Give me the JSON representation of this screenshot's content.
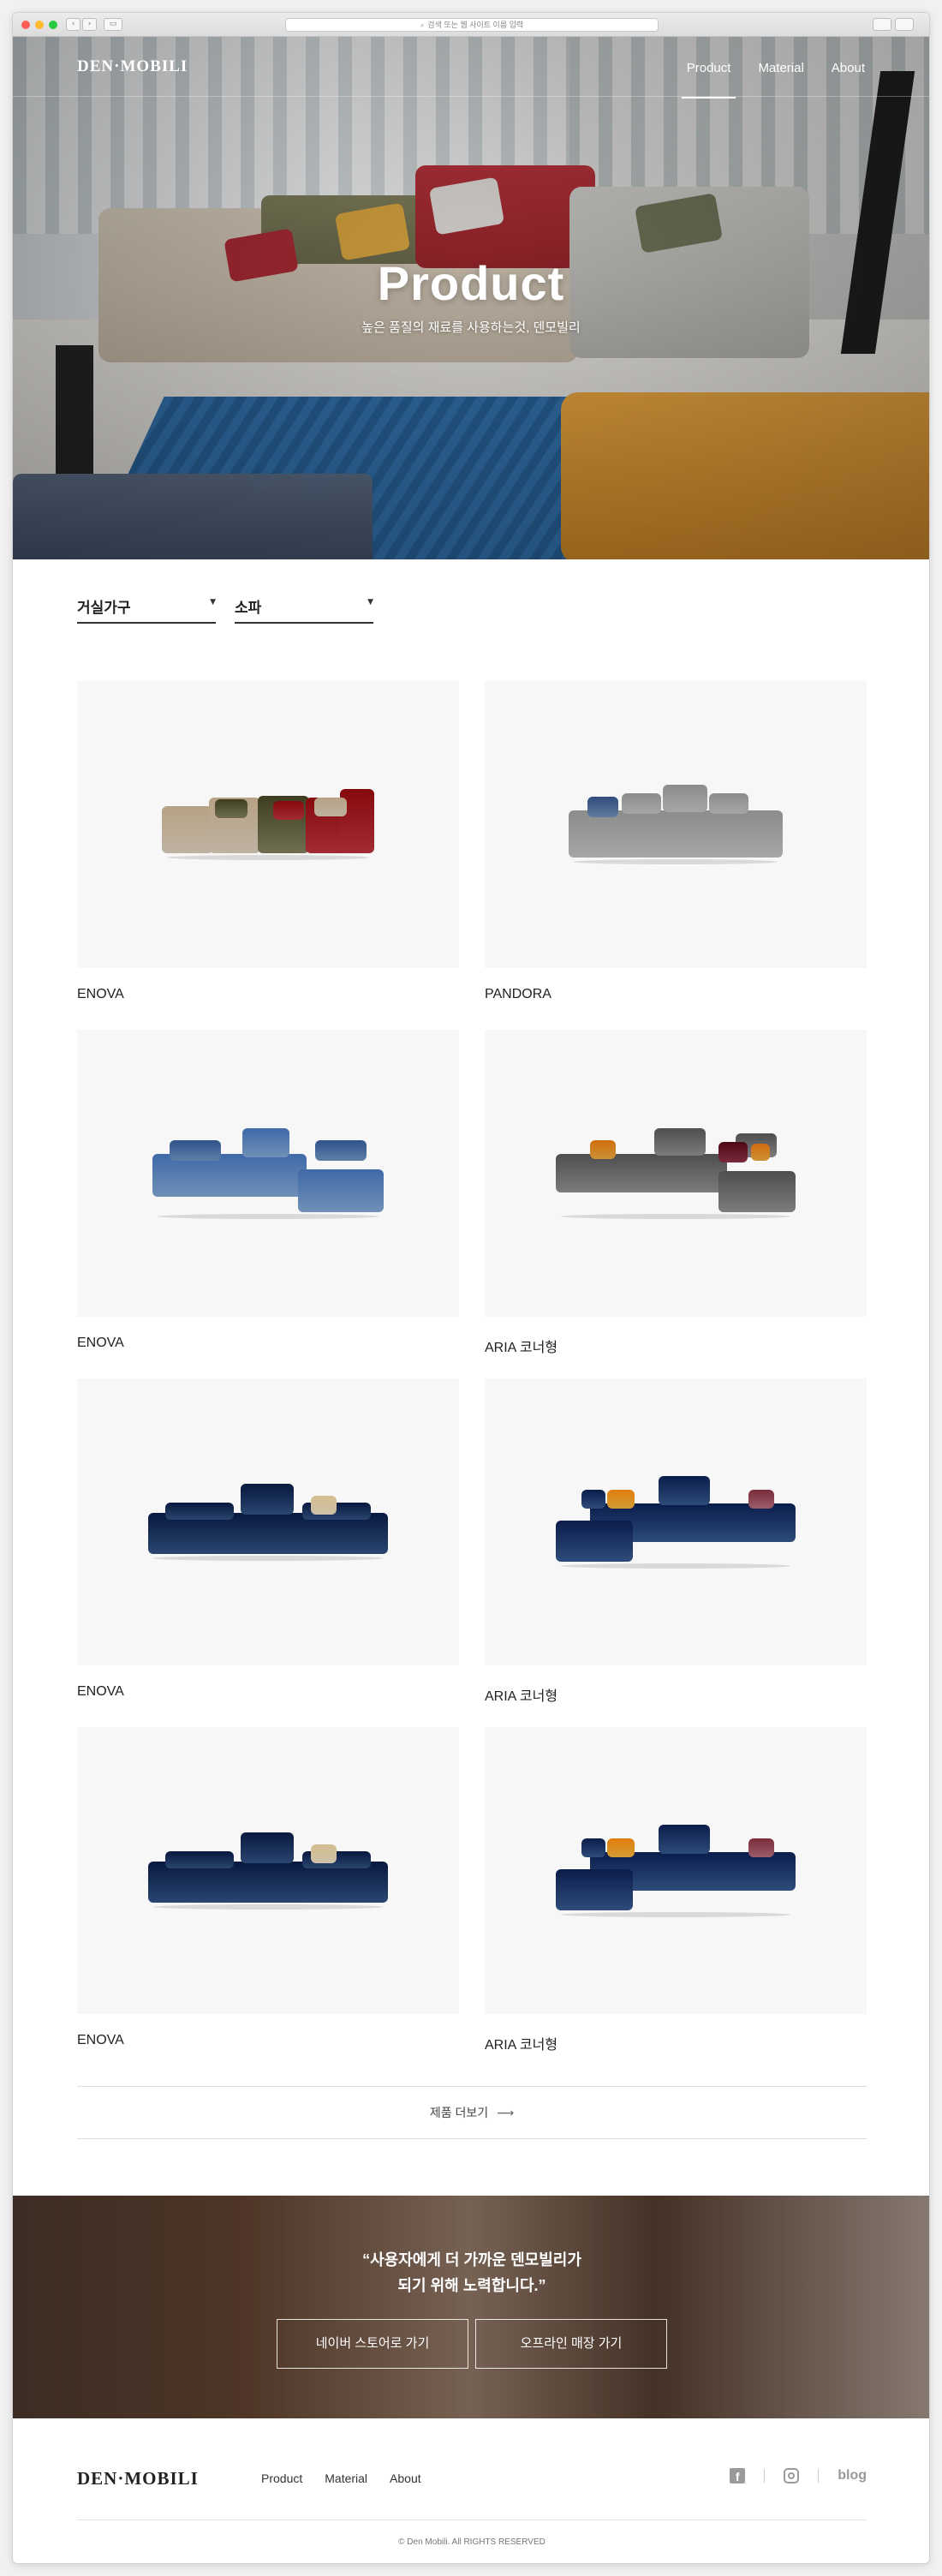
{
  "browser": {
    "address": "검색 또는 웹 사이트 이름 입력"
  },
  "header": {
    "logo": "DEN·MOBILI",
    "nav": [
      "Product",
      "Material",
      "About"
    ]
  },
  "hero": {
    "title": "Product",
    "subtitle": "높은 품질의 재료를 사용하는것, 덴모빌리"
  },
  "filters": {
    "category": "거실가구",
    "subcategory": "소파"
  },
  "products": [
    {
      "name": "ENOVA",
      "style": "modular-multi",
      "colors": [
        "#d8cbb8",
        "#7e7d5c",
        "#b8323a"
      ]
    },
    {
      "name": "PANDORA",
      "style": "grey-recliner",
      "colors": [
        "#bdbdbd",
        "#6f8bb3"
      ]
    },
    {
      "name": "ENOVA",
      "style": "light-blue-corner",
      "colors": [
        "#7fa4cf",
        "#6d91bd"
      ]
    },
    {
      "name": "ARIA 코너형",
      "style": "grey-corner",
      "colors": [
        "#8d8d8d",
        "#8c2f45",
        "#e7a63b"
      ]
    },
    {
      "name": "ENOVA",
      "style": "navy-long",
      "colors": [
        "#2f4f7f",
        "#e9dcc0"
      ]
    },
    {
      "name": "ARIA 코너형",
      "style": "navy-corner",
      "colors": [
        "#34568a",
        "#f0b23b",
        "#b06a79"
      ]
    },
    {
      "name": "ENOVA",
      "style": "navy-long",
      "colors": [
        "#2f4f7f",
        "#e9dcc0"
      ]
    },
    {
      "name": "ARIA 코너형",
      "style": "navy-corner",
      "colors": [
        "#34568a",
        "#f0b23b",
        "#b06a79"
      ]
    }
  ],
  "more": {
    "label": "제품 더보기",
    "arrow": "⟶"
  },
  "banner": {
    "quote_line1": "“사용자에게 더 가까운 덴모빌리가",
    "quote_line2": "되기 위해 노력합니다.”",
    "button_store": "네이버 스토어로 가기",
    "button_offline": "오프라인 매장 가기"
  },
  "footer": {
    "logo": "DEN·MOBILI",
    "nav": [
      "Product",
      "Material",
      "About"
    ],
    "facebook": "f",
    "blog": "blog",
    "copyright": "© Den Mobili. All RIGHTS RESERVED"
  }
}
